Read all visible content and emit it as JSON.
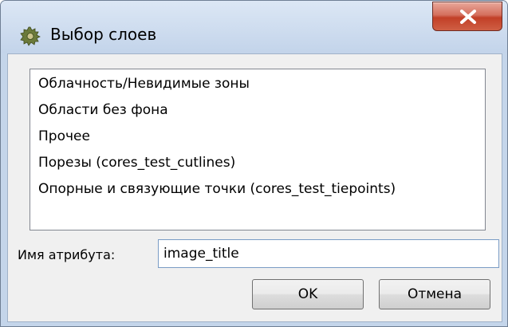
{
  "window": {
    "title": "Выбор слоев",
    "app_icon": "gear-cog-icon",
    "close_icon": "close-x-icon",
    "accent_color": "#c23f27"
  },
  "layers": {
    "items": [
      {
        "label": "Облачность/Невидимые зоны"
      },
      {
        "label": "Области без фона"
      },
      {
        "label": "Прочее"
      },
      {
        "label": "Порезы (cores_test_cutlines)"
      },
      {
        "label": "Опорные и связующие точки (cores_test_tiepoints)"
      }
    ]
  },
  "attribute": {
    "label": "Имя атрибута:",
    "value": "image_title"
  },
  "buttons": {
    "ok_label": "OK",
    "cancel_label": "Отмена"
  }
}
